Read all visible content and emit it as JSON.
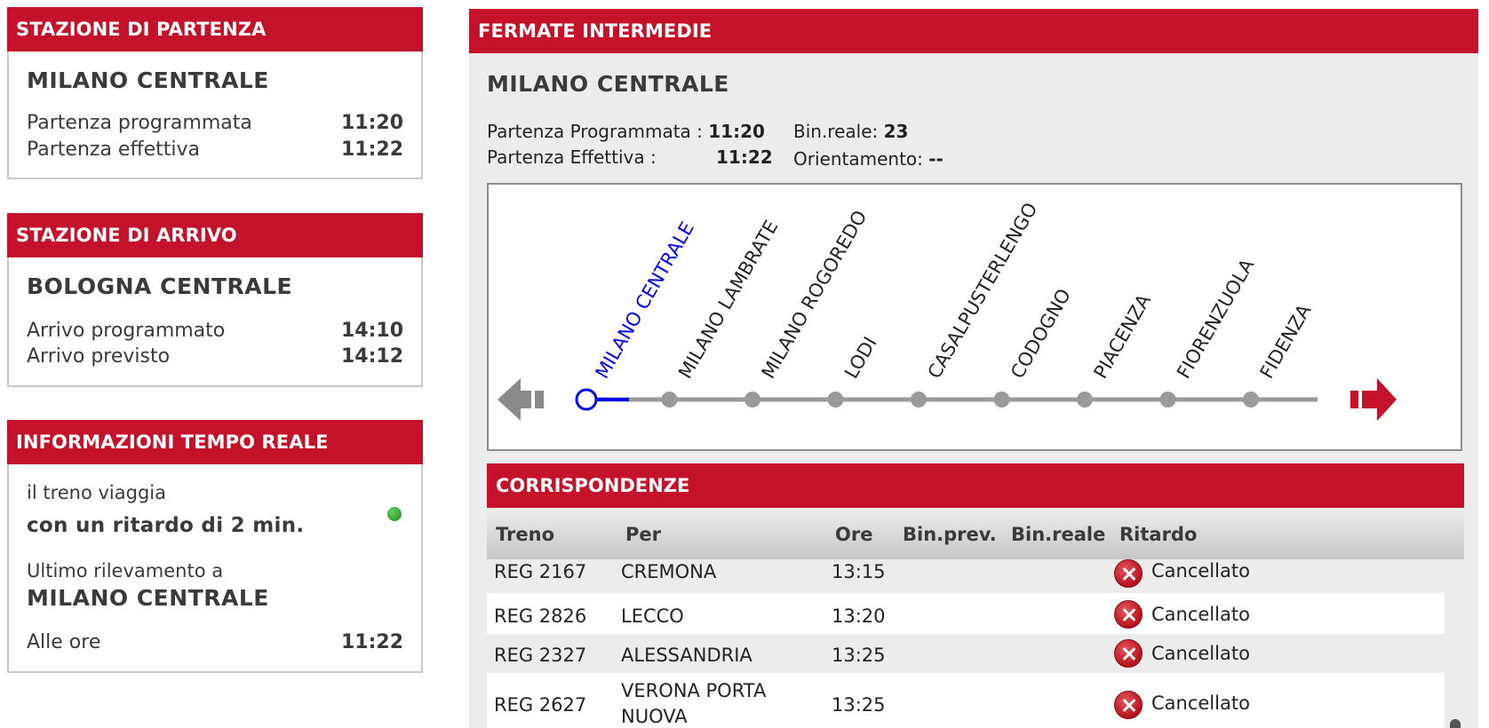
{
  "departure": {
    "header": "STAZIONE DI PARTENZA",
    "station": "MILANO CENTRALE",
    "scheduled_label": "Partenza programmata",
    "scheduled_time": "11:20",
    "actual_label": "Partenza effettiva",
    "actual_time": "11:22"
  },
  "arrival": {
    "header": "STAZIONE DI ARRIVO",
    "station": "BOLOGNA CENTRALE",
    "scheduled_label": "Arrivo programmato",
    "scheduled_time": "14:10",
    "expected_label": "Arrivo previsto",
    "expected_time": "14:12"
  },
  "realtime": {
    "header": "INFORMAZIONI TEMPO REALE",
    "travel_text": "il treno viaggia",
    "delay_text": "con un ritardo di 2 min.",
    "status_color": "#2e9e2e",
    "last_detection_label": "Ultimo rilevamento a",
    "last_station": "MILANO CENTRALE",
    "time_label": "Alle ore",
    "time_value": "11:22"
  },
  "intermediate": {
    "header": "FERMATE INTERMEDIE",
    "station": "MILANO CENTRALE",
    "scheduled_label": "Partenza Programmata :",
    "scheduled_time": "11:20",
    "actual_label": "Partenza Effettiva :",
    "actual_time": "11:22",
    "platform_label": "Bin.reale:",
    "platform_value": "23",
    "orientation_label": "Orientamento:",
    "orientation_value": "--",
    "stops": [
      "MILANO CENTRALE",
      "MILANO LAMBRATE",
      "MILANO ROGOREDO",
      "LODI",
      "CASALPUSTERLENGO",
      "CODOGNO",
      "PIACENZA",
      "FIORENZUOLA",
      "FIDENZA"
    ],
    "current_stop_index": 0,
    "accent_current": "#0000ee",
    "prev_arrow_icon": "arrow-left-icon",
    "next_arrow_icon": "arrow-right-icon"
  },
  "connections": {
    "header": "CORRISPONDENZE",
    "columns": [
      "Treno",
      "Per",
      "Ore",
      "Bin.prev.",
      "Bin.reale",
      "Ritardo"
    ],
    "rows": [
      {
        "train": "REG 2167",
        "to": "CREMONA",
        "time": "13:15",
        "bin_prev": "",
        "bin_real": "",
        "delay": "Cancellato"
      },
      {
        "train": "REG 2826",
        "to": "LECCO",
        "time": "13:20",
        "bin_prev": "",
        "bin_real": "",
        "delay": "Cancellato"
      },
      {
        "train": "REG 2327",
        "to": "ALESSANDRIA",
        "time": "13:25",
        "bin_prev": "",
        "bin_real": "",
        "delay": "Cancellato"
      },
      {
        "train": "REG 2627",
        "to": "VERONA PORTA NUOVA",
        "time": "13:25",
        "bin_prev": "",
        "bin_real": "",
        "delay": "Cancellato"
      }
    ]
  }
}
